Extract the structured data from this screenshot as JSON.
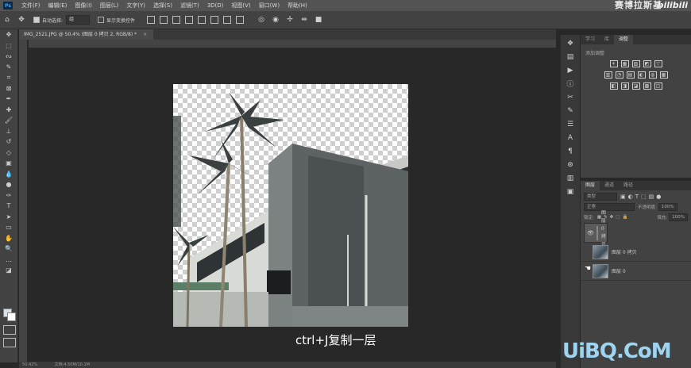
{
  "menubar": {
    "app_logo": "Ps",
    "items": [
      "文件(F)",
      "编辑(E)",
      "图像(I)",
      "图层(L)",
      "文字(Y)",
      "选择(S)",
      "滤镜(T)",
      "3D(D)",
      "视图(V)",
      "窗口(W)",
      "帮助(H)"
    ],
    "brand": "赛博拉斯基",
    "bili": "bilibili"
  },
  "options": {
    "auto_select_label": "自动选择:",
    "auto_select_value": "组",
    "show_transform_label": "显示变换控件"
  },
  "document_tab": {
    "title": "IMG_2521.JPG @ 50.4% (图层 0 拷贝 2, RGB/8) *",
    "close": "×"
  },
  "canvas": {
    "caption": "ctrl+J复制一层"
  },
  "statusbar": {
    "zoom": "50.42%",
    "doc": "文档:4.50M/10.1M"
  },
  "adjustments_panel": {
    "tabs": [
      "学习",
      "库",
      "调整"
    ],
    "active_tab": "调整",
    "title": "添加调整",
    "row1": [
      "☀",
      "▦",
      "▨",
      "◩",
      "▽"
    ],
    "row2": [
      "▥",
      "◔",
      "▤",
      "◐",
      "◍",
      "▦"
    ],
    "row3": [
      "◧",
      "◨",
      "◪",
      "▩",
      "◫"
    ]
  },
  "layers_panel": {
    "tabs": [
      "图层",
      "通道",
      "路径"
    ],
    "active_tab": "图层",
    "filter": "类型",
    "blend_mode": "正常",
    "opacity_label": "不透明度:",
    "opacity_value": "100%",
    "lock_label": "锁定:",
    "fill_label": "填充:",
    "fill_value": "100%",
    "layers": [
      {
        "name": "图层 0 拷贝 2",
        "visible": true,
        "selected": true
      },
      {
        "name": "图层 0 拷贝",
        "visible": false,
        "selected": false
      },
      {
        "name": "图层 0",
        "visible": false,
        "selected": false
      }
    ]
  },
  "watermark": "UiBQ.CoM",
  "colors": {
    "foreground": "#d7e2ea",
    "background": "#ffffff",
    "ps_accent": "#31a8ff"
  }
}
